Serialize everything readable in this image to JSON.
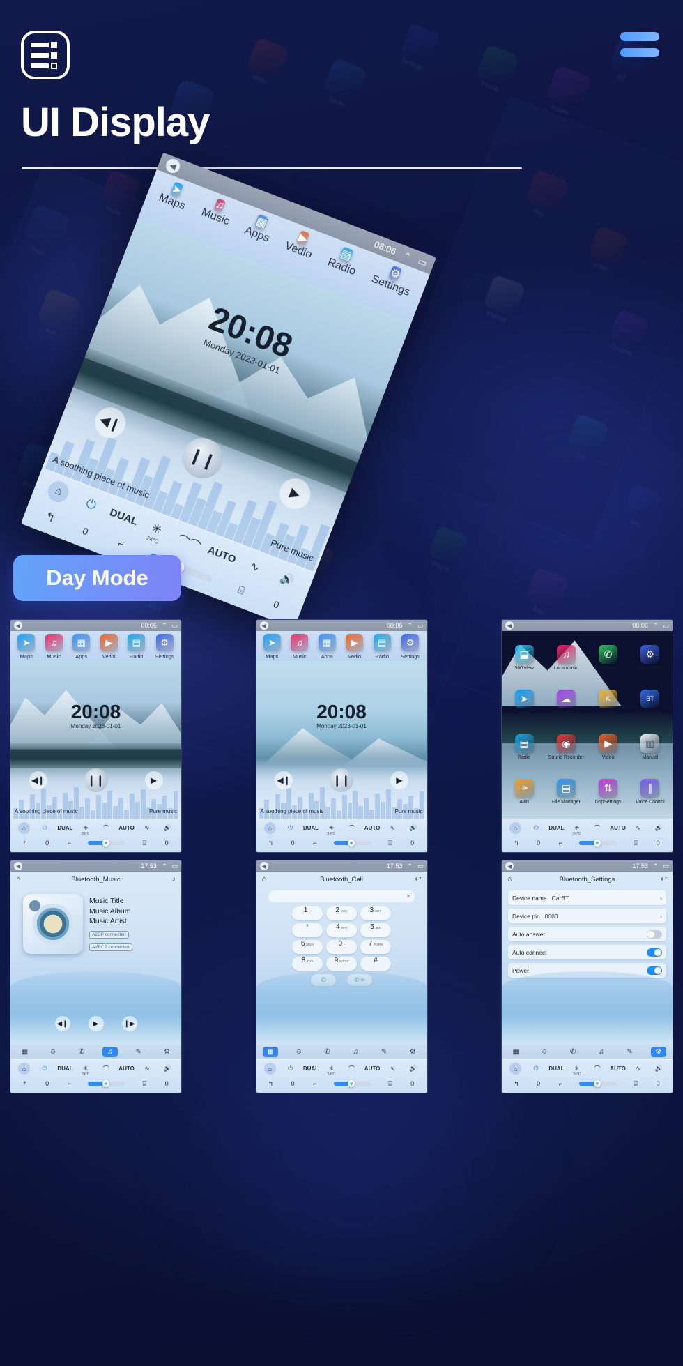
{
  "header": {
    "title": "UI Display",
    "logo_icon": "list-settings-icon",
    "menu_icon": "hamburger-menu-icon"
  },
  "badge": {
    "day_mode_label": "Day Mode"
  },
  "home_screen": {
    "status_time": "08:06",
    "status_icons": [
      "back-icon",
      "chevron-up-icon",
      "window-icon"
    ],
    "dock": [
      {
        "label": "Maps",
        "icon": "navigation-arrow-icon",
        "color": "#19a0f5"
      },
      {
        "label": "Music",
        "icon": "music-note-icon",
        "color": "#f0296b"
      },
      {
        "label": "Apps",
        "icon": "grid-squares-icon",
        "color": "#3f8ef7"
      },
      {
        "label": "Vedio",
        "icon": "play-circle-icon",
        "color": "#f2642a"
      },
      {
        "label": "Radio",
        "icon": "radio-icon",
        "color": "#1fa8e8"
      },
      {
        "label": "Settings",
        "icon": "gear-icon",
        "color": "#3f64e8"
      }
    ],
    "clock_time": "20:08",
    "clock_date": "Monday  2023-01-01",
    "media": {
      "prev_icon": "skip-back-icon",
      "play_icon": "pause-icon",
      "next_icon": "skip-forward-icon",
      "track_name": "A soothing piece of music",
      "source_label": "Pure music"
    },
    "climate": {
      "home_icon": "home-icon",
      "power_icon": "power-icon",
      "dual_label": "DUAL",
      "snow_icon": "snowflake-icon",
      "defrost_icon": "defrost-icon",
      "auto_label": "AUTO",
      "airflow_icon": "airflow-icon",
      "volume_icon": "volume-icon",
      "back_icon": "back-arrow-icon",
      "left_value": "0",
      "right_value": "0",
      "seat_icon": "seat-icon",
      "fan_icon": "fan-icon",
      "seat_heat_icon": "seat-heater-icon",
      "temp_label": "24°C"
    }
  },
  "apps_screen": {
    "status_time": "08:06",
    "apps": [
      {
        "label": "360 view",
        "icon": "car-360-icon",
        "color": "#2ec6f0"
      },
      {
        "label": "Localmusic",
        "icon": "music-note-icon",
        "color": "#f0296b"
      },
      {
        "label": "Phone",
        "icon": "phone-icon",
        "color": "#2fc55e"
      },
      {
        "label": "Car Settings",
        "icon": "gear-icon",
        "color": "#3f64e8"
      },
      {
        "label": "Maps",
        "icon": "navigation-arrow-icon",
        "color": "#19a0f5"
      },
      {
        "label": "Original Car",
        "icon": "car-cloud-icon",
        "color": "#a743f0"
      },
      {
        "label": "Kuwoo",
        "icon": "kuwo-icon",
        "color": "#f0b23a"
      },
      {
        "label": "Bluetooth",
        "icon": "bluetooth-icon",
        "color": "#2f6ff0"
      },
      {
        "label": "Radio",
        "icon": "radio-icon",
        "color": "#1fa8e8"
      },
      {
        "label": "Sound Recorder",
        "icon": "record-icon",
        "color": "#e83a3a"
      },
      {
        "label": "Video",
        "icon": "play-circle-icon",
        "color": "#f2642a"
      },
      {
        "label": "Manual",
        "icon": "book-icon",
        "color": "#f5f7fb"
      },
      {
        "label": "Avin",
        "icon": "avin-icon",
        "color": "#f5a028"
      },
      {
        "label": "File Manager",
        "icon": "folder-icon",
        "color": "#2b97e8"
      },
      {
        "label": "DspSettings",
        "icon": "sliders-icon",
        "color": "#c23ae0"
      },
      {
        "label": "Voice Control",
        "icon": "waveform-icon",
        "color": "#7a5cf0"
      }
    ]
  },
  "bluetooth_music": {
    "status_time": "17:53",
    "title": "Bluetooth_Music",
    "home_icon": "home-icon",
    "note_icon": "music-note-icon",
    "meta": [
      "Music Title",
      "Music Album",
      "Music Artist"
    ],
    "chips": [
      "A2DP  connected",
      "AVRCP connected"
    ],
    "controls": [
      "skip-back-icon",
      "play-icon",
      "skip-forward-icon"
    ],
    "tabs": [
      "keypad-icon",
      "contacts-icon",
      "phone-icon",
      "music-note-icon",
      "link-icon",
      "gear-icon"
    ],
    "active_tab": 3
  },
  "bluetooth_call": {
    "status_time": "17:53",
    "title": "Bluetooth_Call",
    "back_icon": "back-arrow-icon",
    "input_value": "",
    "clear_icon": "clear-x-icon",
    "keys": [
      {
        "d": "1",
        "s": "~"
      },
      {
        "d": "2",
        "s": "ABC"
      },
      {
        "d": "3",
        "s": "DEF"
      },
      {
        "d": "*",
        "s": ""
      },
      {
        "d": "4",
        "s": "GHI"
      },
      {
        "d": "5",
        "s": "JKL"
      },
      {
        "d": "6",
        "s": "MNO"
      },
      {
        "d": "0",
        "s": "-"
      },
      {
        "d": "7",
        "s": "PQRS"
      },
      {
        "d": "8",
        "s": "TUV"
      },
      {
        "d": "9",
        "s": "WXYZ"
      },
      {
        "d": "#",
        "s": ""
      }
    ],
    "call_label": "",
    "call_icon": "phone-call-icon",
    "delete_icon": "backspace-icon",
    "delete_label": "Re",
    "tabs": [
      "keypad-icon",
      "contacts-icon",
      "phone-icon",
      "music-note-icon",
      "link-icon",
      "gear-icon"
    ],
    "active_tab": 0
  },
  "bluetooth_settings": {
    "status_time": "17:53",
    "title": "Bluetooth_Settings",
    "rows": [
      {
        "label": "Device name",
        "value": "CarBT",
        "type": "chevron"
      },
      {
        "label": "Device pin",
        "value": "0000",
        "type": "chevron"
      },
      {
        "label": "Auto answer",
        "value": "",
        "type": "toggle",
        "on": false
      },
      {
        "label": "Auto connect",
        "value": "",
        "type": "toggle",
        "on": true
      },
      {
        "label": "Power",
        "value": "",
        "type": "toggle",
        "on": true
      }
    ],
    "tabs": [
      "keypad-icon",
      "contacts-icon",
      "phone-icon",
      "music-note-icon",
      "link-icon",
      "gear-icon"
    ],
    "active_tab": 5
  },
  "colors": {
    "accent_blue": "#2f86ef",
    "badge_start": "#62a4fb",
    "badge_end": "#7f83f6",
    "page_bg": "#0d1440"
  }
}
